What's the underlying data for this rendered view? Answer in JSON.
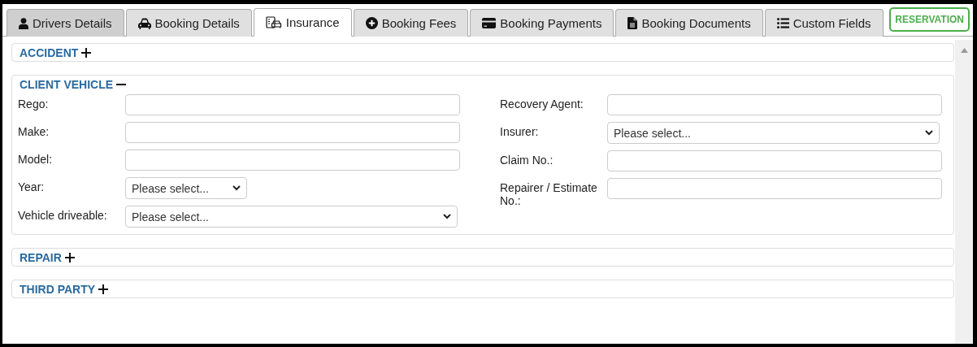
{
  "tabs": [
    {
      "label": "Drivers Details",
      "selected": false,
      "highlighted": true
    },
    {
      "label": "Booking Details",
      "selected": false,
      "highlighted": false
    },
    {
      "label": "Insurance",
      "selected": true,
      "highlighted": false
    },
    {
      "label": "Booking Fees",
      "selected": false,
      "highlighted": false
    },
    {
      "label": "Booking Payments",
      "selected": false,
      "highlighted": false
    },
    {
      "label": "Booking Documents",
      "selected": false,
      "highlighted": false
    },
    {
      "label": "Custom Fields",
      "selected": false,
      "highlighted": false
    }
  ],
  "status_button": {
    "label": "RESERVATION"
  },
  "sections": [
    {
      "title": "ACCIDENT",
      "expanded": false
    },
    {
      "title": "CLIENT VEHICLE",
      "expanded": true,
      "left_fields": [
        {
          "label": "Rego:",
          "kind": "text"
        },
        {
          "label": "Make:",
          "kind": "text"
        },
        {
          "label": "Model:",
          "kind": "text"
        },
        {
          "label": "Year:",
          "kind": "shortselect",
          "value": "Please select..."
        },
        {
          "label": "Vehicle driveable:",
          "kind": "select",
          "value": "Please select..."
        }
      ],
      "right_fields": [
        {
          "label": "Recovery Agent:",
          "kind": "text"
        },
        {
          "label": "Insurer:",
          "kind": "select",
          "value": "Please select..."
        },
        {
          "label": "Claim No.:",
          "kind": "text"
        },
        {
          "label": "Repairer / Estimate No.:",
          "kind": "text"
        }
      ]
    },
    {
      "title": "REPAIR",
      "expanded": false
    },
    {
      "title": "THIRD PARTY",
      "expanded": false
    }
  ]
}
